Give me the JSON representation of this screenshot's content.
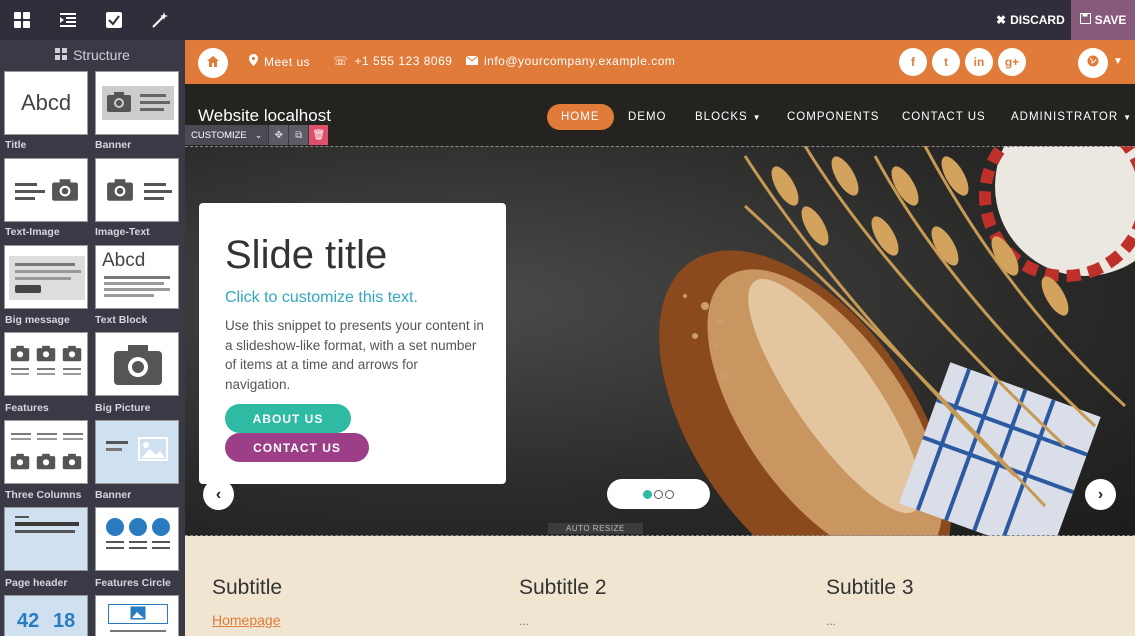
{
  "editor": {
    "discard_label": "DISCARD",
    "save_label": "SAVE",
    "tool_icons": [
      "blocks-icon",
      "indent-icon",
      "checkbox-icon",
      "magic-wand-icon"
    ]
  },
  "panel": {
    "title": "Structure",
    "snippets": [
      {
        "label": "Title"
      },
      {
        "label": "Banner"
      },
      {
        "label": "Text-Image"
      },
      {
        "label": "Image-Text"
      },
      {
        "label": "Big message"
      },
      {
        "label": "Text Block"
      },
      {
        "label": "Features"
      },
      {
        "label": "Big Picture"
      },
      {
        "label": "Three Columns"
      },
      {
        "label": "Banner"
      },
      {
        "label": "Page header"
      },
      {
        "label": "Features Circle"
      }
    ],
    "title_thumb_text": "Abcd",
    "textblock_thumb_text": "Abcd",
    "stats_thumb": [
      "42",
      "18"
    ]
  },
  "site": {
    "contact": {
      "meet": "Meet us",
      "phone": "+1 555 123 8069",
      "email": "info@yourcompany.example.com"
    },
    "social": [
      "f",
      "t",
      "in",
      "g+"
    ],
    "brand": "Website localhost",
    "nav": [
      "HOME",
      "DEMO",
      "BLOCKS",
      "COMPONENTS",
      "CONTACT US",
      "ADMINISTRATOR"
    ],
    "customize_label": "CUSTOMIZE",
    "slide": {
      "title": "Slide title",
      "subtitle": "Click to customize this text.",
      "text": "Use this snippet to presents your content in a slideshow-like format, with a set number of items at a time and arrows for navigation.",
      "btn_about": "ABOUT US",
      "btn_contact": "CONTACT US"
    },
    "auto_resize": "AUTO RESIZE",
    "columns": [
      {
        "title": "Subtitle",
        "link": "Homepage"
      },
      {
        "title": "Subtitle 2",
        "text": "..."
      },
      {
        "title": "Subtitle 3",
        "text": "..."
      }
    ]
  },
  "colors": {
    "accent": "#e07b3a",
    "save": "#875a7b",
    "teal": "#2fbaa3",
    "purple": "#9c3f88"
  }
}
